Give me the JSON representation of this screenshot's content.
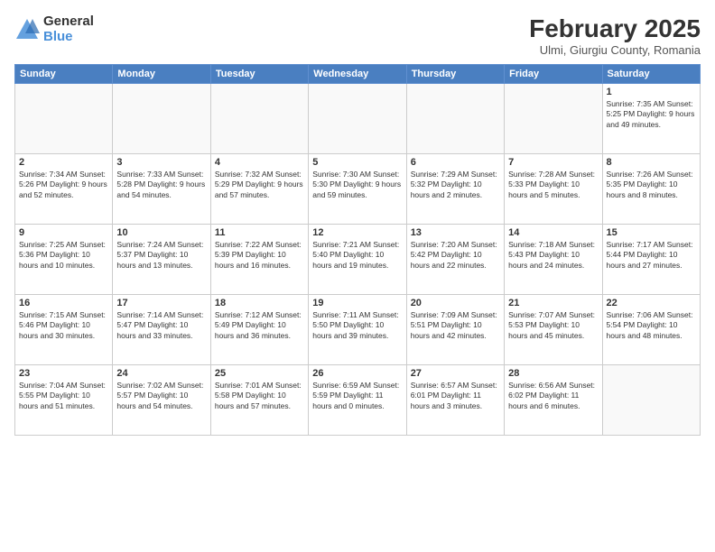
{
  "logo": {
    "general": "General",
    "blue": "Blue"
  },
  "header": {
    "month_year": "February 2025",
    "location": "Ulmi, Giurgiu County, Romania"
  },
  "weekdays": [
    "Sunday",
    "Monday",
    "Tuesday",
    "Wednesday",
    "Thursday",
    "Friday",
    "Saturday"
  ],
  "weeks": [
    [
      {
        "day": "",
        "info": ""
      },
      {
        "day": "",
        "info": ""
      },
      {
        "day": "",
        "info": ""
      },
      {
        "day": "",
        "info": ""
      },
      {
        "day": "",
        "info": ""
      },
      {
        "day": "",
        "info": ""
      },
      {
        "day": "1",
        "info": "Sunrise: 7:35 AM\nSunset: 5:25 PM\nDaylight: 9 hours and 49 minutes."
      }
    ],
    [
      {
        "day": "2",
        "info": "Sunrise: 7:34 AM\nSunset: 5:26 PM\nDaylight: 9 hours and 52 minutes."
      },
      {
        "day": "3",
        "info": "Sunrise: 7:33 AM\nSunset: 5:28 PM\nDaylight: 9 hours and 54 minutes."
      },
      {
        "day": "4",
        "info": "Sunrise: 7:32 AM\nSunset: 5:29 PM\nDaylight: 9 hours and 57 minutes."
      },
      {
        "day": "5",
        "info": "Sunrise: 7:30 AM\nSunset: 5:30 PM\nDaylight: 9 hours and 59 minutes."
      },
      {
        "day": "6",
        "info": "Sunrise: 7:29 AM\nSunset: 5:32 PM\nDaylight: 10 hours and 2 minutes."
      },
      {
        "day": "7",
        "info": "Sunrise: 7:28 AM\nSunset: 5:33 PM\nDaylight: 10 hours and 5 minutes."
      },
      {
        "day": "8",
        "info": "Sunrise: 7:26 AM\nSunset: 5:35 PM\nDaylight: 10 hours and 8 minutes."
      }
    ],
    [
      {
        "day": "9",
        "info": "Sunrise: 7:25 AM\nSunset: 5:36 PM\nDaylight: 10 hours and 10 minutes."
      },
      {
        "day": "10",
        "info": "Sunrise: 7:24 AM\nSunset: 5:37 PM\nDaylight: 10 hours and 13 minutes."
      },
      {
        "day": "11",
        "info": "Sunrise: 7:22 AM\nSunset: 5:39 PM\nDaylight: 10 hours and 16 minutes."
      },
      {
        "day": "12",
        "info": "Sunrise: 7:21 AM\nSunset: 5:40 PM\nDaylight: 10 hours and 19 minutes."
      },
      {
        "day": "13",
        "info": "Sunrise: 7:20 AM\nSunset: 5:42 PM\nDaylight: 10 hours and 22 minutes."
      },
      {
        "day": "14",
        "info": "Sunrise: 7:18 AM\nSunset: 5:43 PM\nDaylight: 10 hours and 24 minutes."
      },
      {
        "day": "15",
        "info": "Sunrise: 7:17 AM\nSunset: 5:44 PM\nDaylight: 10 hours and 27 minutes."
      }
    ],
    [
      {
        "day": "16",
        "info": "Sunrise: 7:15 AM\nSunset: 5:46 PM\nDaylight: 10 hours and 30 minutes."
      },
      {
        "day": "17",
        "info": "Sunrise: 7:14 AM\nSunset: 5:47 PM\nDaylight: 10 hours and 33 minutes."
      },
      {
        "day": "18",
        "info": "Sunrise: 7:12 AM\nSunset: 5:49 PM\nDaylight: 10 hours and 36 minutes."
      },
      {
        "day": "19",
        "info": "Sunrise: 7:11 AM\nSunset: 5:50 PM\nDaylight: 10 hours and 39 minutes."
      },
      {
        "day": "20",
        "info": "Sunrise: 7:09 AM\nSunset: 5:51 PM\nDaylight: 10 hours and 42 minutes."
      },
      {
        "day": "21",
        "info": "Sunrise: 7:07 AM\nSunset: 5:53 PM\nDaylight: 10 hours and 45 minutes."
      },
      {
        "day": "22",
        "info": "Sunrise: 7:06 AM\nSunset: 5:54 PM\nDaylight: 10 hours and 48 minutes."
      }
    ],
    [
      {
        "day": "23",
        "info": "Sunrise: 7:04 AM\nSunset: 5:55 PM\nDaylight: 10 hours and 51 minutes."
      },
      {
        "day": "24",
        "info": "Sunrise: 7:02 AM\nSunset: 5:57 PM\nDaylight: 10 hours and 54 minutes."
      },
      {
        "day": "25",
        "info": "Sunrise: 7:01 AM\nSunset: 5:58 PM\nDaylight: 10 hours and 57 minutes."
      },
      {
        "day": "26",
        "info": "Sunrise: 6:59 AM\nSunset: 5:59 PM\nDaylight: 11 hours and 0 minutes."
      },
      {
        "day": "27",
        "info": "Sunrise: 6:57 AM\nSunset: 6:01 PM\nDaylight: 11 hours and 3 minutes."
      },
      {
        "day": "28",
        "info": "Sunrise: 6:56 AM\nSunset: 6:02 PM\nDaylight: 11 hours and 6 minutes."
      },
      {
        "day": "",
        "info": ""
      }
    ]
  ]
}
